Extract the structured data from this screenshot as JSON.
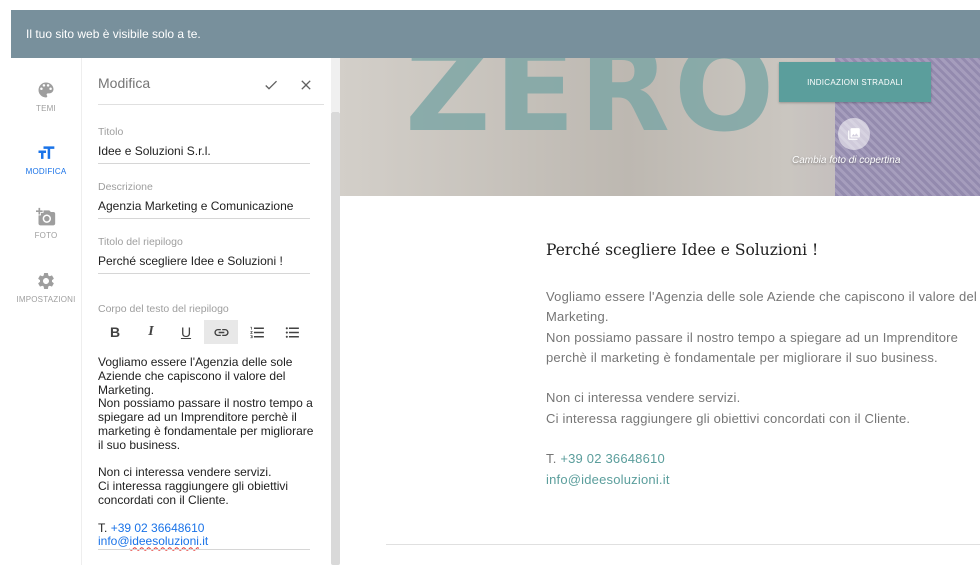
{
  "banner": {
    "text": "Il tuo sito web è visibile solo a te."
  },
  "nav": [
    {
      "icon": "palette-icon",
      "label": "TEMI"
    },
    {
      "icon": "text-size-icon",
      "label": "MODIFICA"
    },
    {
      "icon": "add-photo-icon",
      "label": "FOTO"
    },
    {
      "icon": "settings-icon",
      "label": "IMPOSTAZIONI"
    }
  ],
  "editor": {
    "title": "Modifica",
    "confirm_icon": "check-icon",
    "close_icon": "close-icon",
    "fields": {
      "title_label": "Titolo",
      "title_value": "Idee e Soluzioni S.r.l.",
      "description_label": "Descrizione",
      "description_value": "Agenzia Marketing e Comunicazione",
      "summary_title_label": "Titolo del riepilogo",
      "summary_title_value": "Perché scegliere Idee e Soluzioni !",
      "summary_body_label": "Corpo del testo del riepilogo"
    },
    "toolbar": {
      "bold": "B",
      "italic": "I",
      "underline": "U",
      "link_icon": "link-icon",
      "numbered_icon": "numbered-list-icon",
      "bullet_icon": "bullet-list-icon"
    },
    "body": {
      "p1": "Vogliamo essere l'Agenzia delle sole Aziende che capiscono il valore del Marketing.",
      "p2": "Non possiamo passare il nostro tempo a spiegare ad un Imprenditore perchè il marketing è fondamentale per migliorare il suo business.",
      "p3": "Non ci interessa vendere servizi.",
      "p4": "Ci interessa raggiungere gli obiettivi concordati con il Cliente.",
      "phone_prefix": "T.",
      "phone": "+39 02 36648610",
      "email_user": "info@",
      "email_domain": "ideesoluzioni",
      "email_tld": ".it"
    }
  },
  "preview": {
    "cover_word": "ZERO",
    "directions_button": "INDICAZIONI STRADALI",
    "change_cover_label": "Cambia foto di copertina",
    "change_cover_icon": "photo-library-icon",
    "summary_title": "Perché scegliere Idee e Soluzioni !",
    "line1": "Vogliamo essere l'Agenzia delle sole Aziende che capiscono il valore del",
    "line2": "Marketing.",
    "line3": "Non possiamo passare il nostro tempo a spiegare ad un Imprenditore",
    "line4": "perchè il marketing è fondamentale per migliorare il suo business.",
    "line5": "Non ci interessa vendere servizi.",
    "line6": "Ci interessa raggiungere gli obiettivi concordati con il Cliente.",
    "phone_prefix": "T.",
    "phone": "+39 02 36648610",
    "email": "info@ideesoluzioni.it"
  },
  "colors": {
    "banner": "#78909c",
    "accent": "#5b9e9c",
    "link": "#1a73e8"
  }
}
